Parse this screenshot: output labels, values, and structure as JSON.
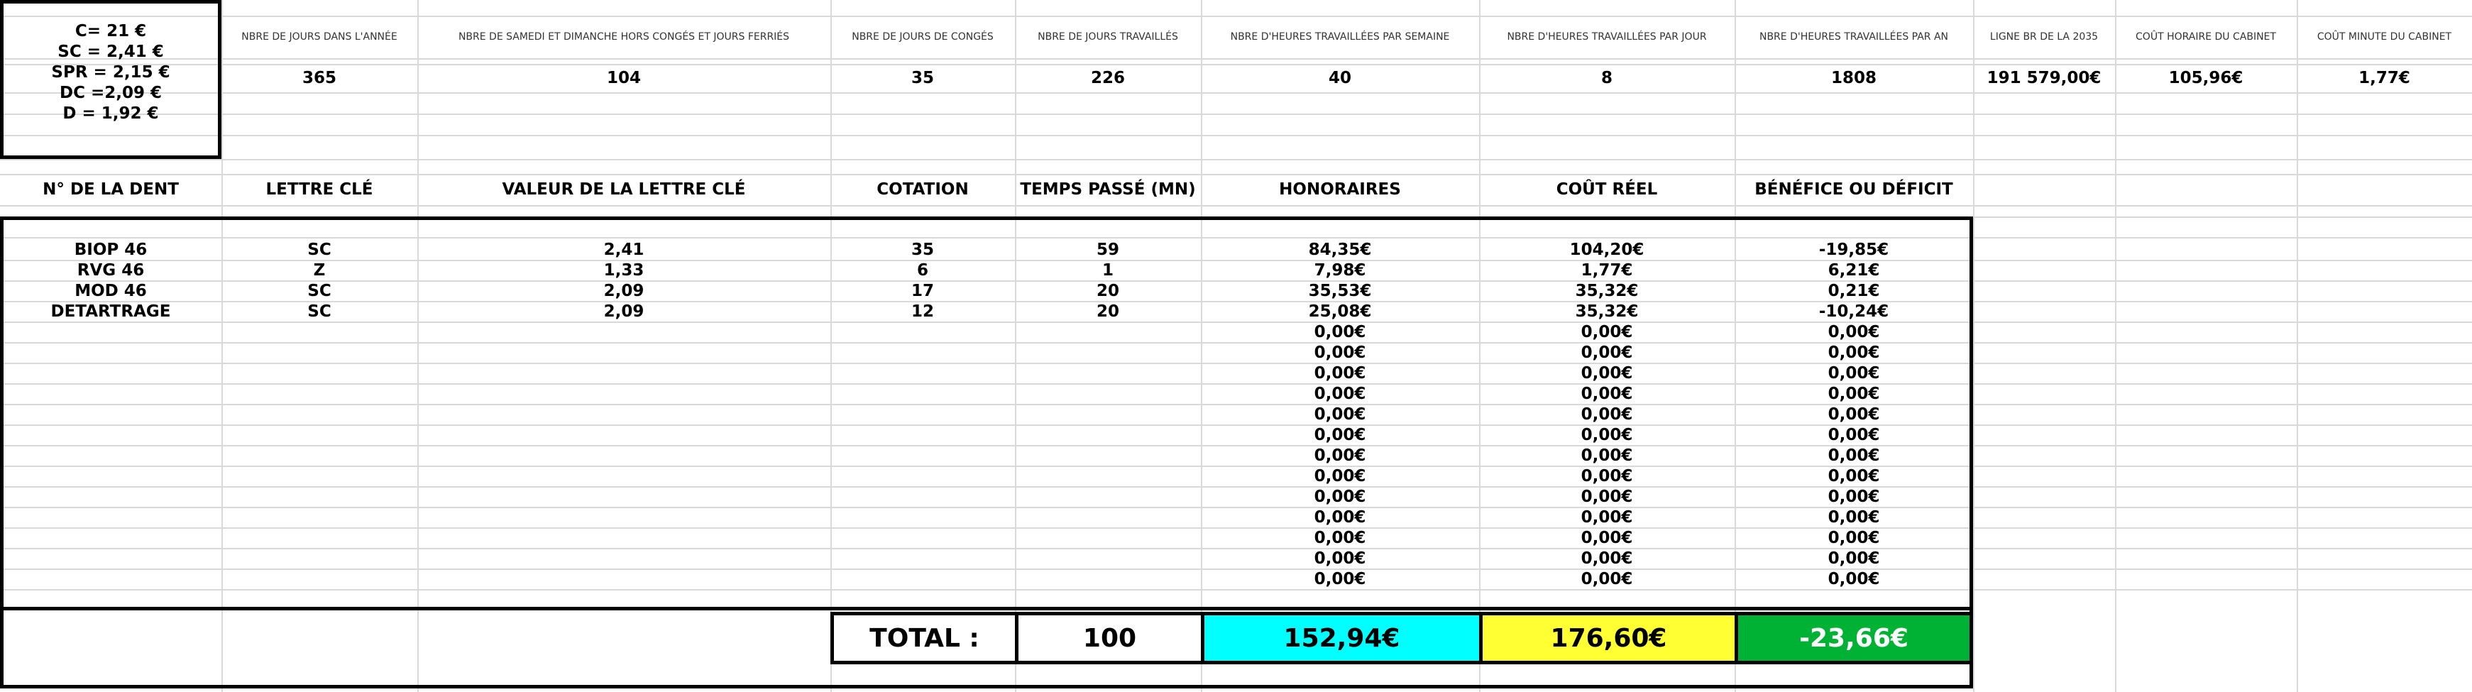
{
  "rates": [
    "C= 21 €",
    "SC = 2,41 €",
    "SPR = 2,15 €",
    "DC =2,09 €",
    "D = 1,92 €"
  ],
  "top_headers": [
    "NBRE DE JOURS DANS L'ANNÉE",
    "NBRE DE SAMEDI ET DIMANCHE HORS CONGÉS ET JOURS FERRIÉS",
    "NBRE DE JOURS DE CONGÉS",
    "NBRE DE JOURS TRAVAILLÉS",
    "NBRE D'HEURES TRAVAILLÉES PAR SEMAINE",
    "NBRE D'HEURES TRAVAILLÉES PAR JOUR",
    "NBRE D'HEURES TRAVAILLÉES PAR AN",
    "LIGNE BR DE LA 2035",
    "COÛT HORAIRE DU CABINET",
    "COÛT MINUTE DU CABINET"
  ],
  "top_values": [
    "365",
    "104",
    "35",
    "226",
    "40",
    "8",
    "1808",
    "191 579,00€",
    "105,96€",
    "1,77€"
  ],
  "table_headers": [
    "N° DE LA DENT",
    "LETTRE CLÉ",
    "VALEUR DE LA LETTRE CLÉ",
    "COTATION",
    "TEMPS PASSÉ (MN)",
    "HONORAIRES",
    "COÛT RÉEL",
    "BÉNÉFICE OU DÉFICIT"
  ],
  "rows": [
    [
      "BIOP 46",
      "SC",
      "2,41",
      "35",
      "59",
      "84,35€",
      "104,20€",
      "-19,85€"
    ],
    [
      "RVG 46",
      "Z",
      "1,33",
      "6",
      "1",
      "7,98€",
      "1,77€",
      "6,21€"
    ],
    [
      "MOD 46",
      "SC",
      "2,09",
      "17",
      "20",
      "35,53€",
      "35,32€",
      "0,21€"
    ],
    [
      "DETARTRAGE",
      "SC",
      "2,09",
      "12",
      "20",
      "25,08€",
      "35,32€",
      "-10,24€"
    ],
    [
      "",
      "",
      "",
      "",
      "",
      "0,00€",
      "0,00€",
      "0,00€"
    ],
    [
      "",
      "",
      "",
      "",
      "",
      "0,00€",
      "0,00€",
      "0,00€"
    ],
    [
      "",
      "",
      "",
      "",
      "",
      "0,00€",
      "0,00€",
      "0,00€"
    ],
    [
      "",
      "",
      "",
      "",
      "",
      "0,00€",
      "0,00€",
      "0,00€"
    ],
    [
      "",
      "",
      "",
      "",
      "",
      "0,00€",
      "0,00€",
      "0,00€"
    ],
    [
      "",
      "",
      "",
      "",
      "",
      "0,00€",
      "0,00€",
      "0,00€"
    ],
    [
      "",
      "",
      "",
      "",
      "",
      "0,00€",
      "0,00€",
      "0,00€"
    ],
    [
      "",
      "",
      "",
      "",
      "",
      "0,00€",
      "0,00€",
      "0,00€"
    ],
    [
      "",
      "",
      "",
      "",
      "",
      "0,00€",
      "0,00€",
      "0,00€"
    ],
    [
      "",
      "",
      "",
      "",
      "",
      "0,00€",
      "0,00€",
      "0,00€"
    ],
    [
      "",
      "",
      "",
      "",
      "",
      "0,00€",
      "0,00€",
      "0,00€"
    ],
    [
      "",
      "",
      "",
      "",
      "",
      "0,00€",
      "0,00€",
      "0,00€"
    ],
    [
      "",
      "",
      "",
      "",
      "",
      "0,00€",
      "0,00€",
      "0,00€"
    ]
  ],
  "totals": {
    "label": "TOTAL :",
    "time": "100",
    "honoraires": "152,94€",
    "cout_reel": "176,60€",
    "benefice": "-23,66€"
  },
  "colors": {
    "honoraires_fill": "#00ffff",
    "cout_reel_fill": "#ffff33",
    "benefice_fill": "#00b233"
  }
}
